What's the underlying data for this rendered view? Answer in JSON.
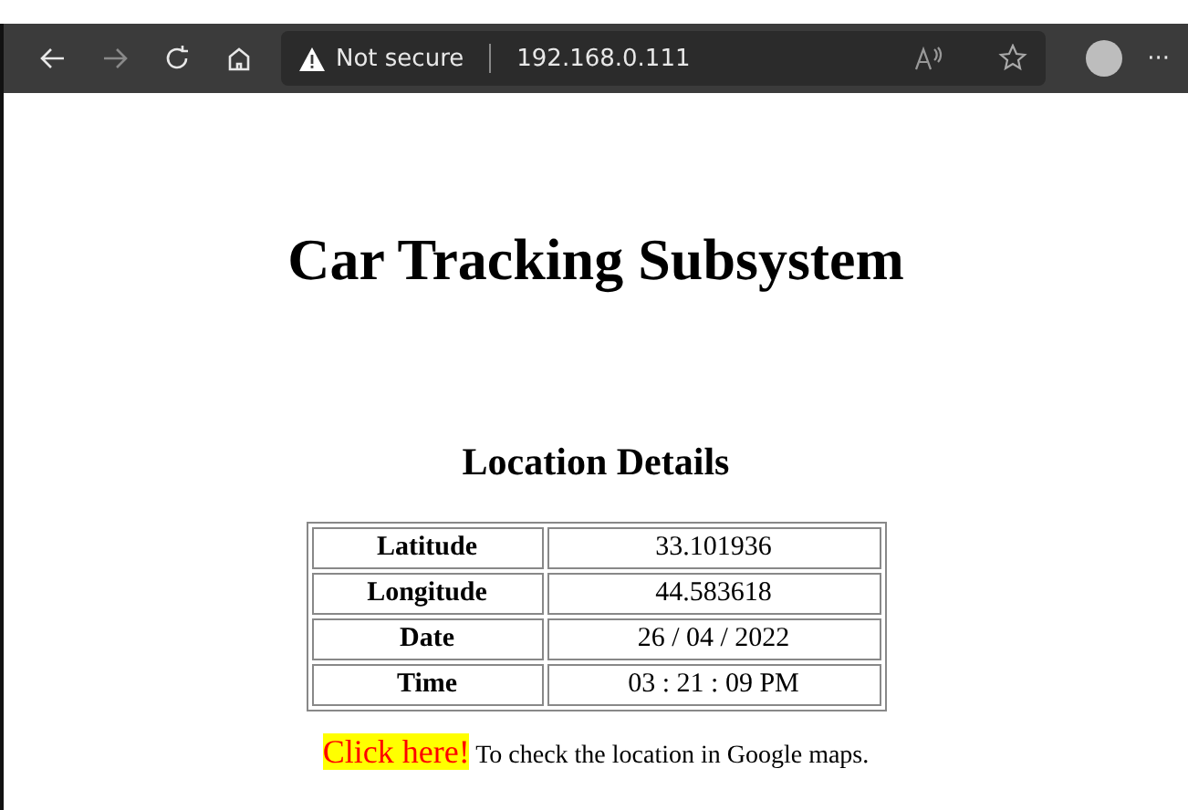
{
  "toolbar": {
    "security_label": "Not secure",
    "address": "192.168.0.111",
    "more": "···"
  },
  "page": {
    "title": "Car Tracking Subsystem",
    "section_title": "Location Details",
    "rows": [
      {
        "label": "Latitude",
        "value": "33.101936"
      },
      {
        "label": "Longitude",
        "value": "44.583618"
      },
      {
        "label": "Date",
        "value": "26 / 04 / 2022"
      },
      {
        "label": "Time",
        "value": "03 : 21 : 09 PM"
      }
    ],
    "link": "Click here!",
    "link_note": "To check the location in Google maps."
  }
}
